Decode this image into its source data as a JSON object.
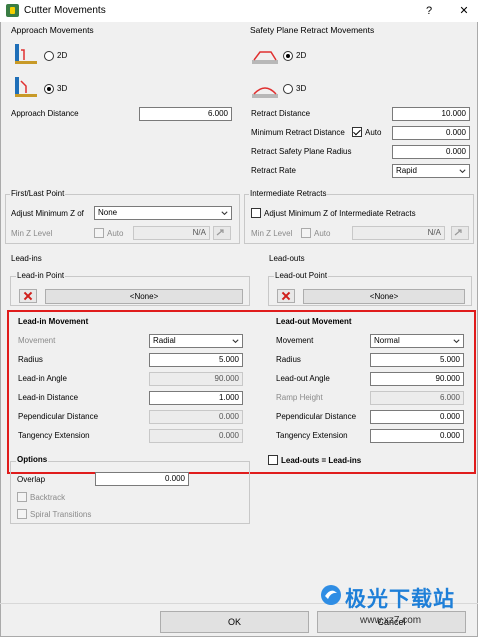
{
  "window": {
    "title": "Cutter Movements",
    "help": "?",
    "close": "✕"
  },
  "approach": {
    "title": "Approach Movements",
    "opt_2d": "2D",
    "opt_3d": "3D",
    "selected": "3D",
    "distance_label": "Approach Distance",
    "distance_value": "6.000"
  },
  "safety": {
    "title": "Safety Plane Retract Movements",
    "opt_2d": "2D",
    "opt_3d": "3D",
    "selected": "2D",
    "retract_distance_label": "Retract Distance",
    "retract_distance_value": "10.000",
    "min_retract_label": "Minimum Retract Distance",
    "auto_label": "Auto",
    "auto_checked": true,
    "min_retract_value": "0.000",
    "retract_radius_label": "Retract Safety Plane Radius",
    "retract_radius_value": "0.000",
    "retract_rate_label": "Retract Rate",
    "retract_rate_value": "Rapid"
  },
  "first_last": {
    "title": "First/Last Point",
    "adjust_label": "Adjust Minimum Z of",
    "adjust_value": "None",
    "min_z_label": "Min Z Level",
    "auto_label": "Auto",
    "min_z_value": "N/A"
  },
  "intermediate": {
    "title": "Intermediate Retracts",
    "adjust_label": "Adjust Minimum Z of Intermediate Retracts",
    "min_z_label": "Min Z Level",
    "auto_label": "Auto",
    "min_z_value": "N/A"
  },
  "leadins": {
    "title": "Lead-ins",
    "point_title": "Lead-in Point",
    "point_value": "<None>",
    "movement_title": "Lead-in Movement",
    "rows": [
      {
        "label": "Movement",
        "value": "Radial"
      },
      {
        "label": "Radius",
        "value": "5.000"
      },
      {
        "label": "Lead-in Angle",
        "value": "90.000"
      },
      {
        "label": "Lead-in Distance",
        "value": "1.000"
      },
      {
        "label": "Pependicular Distance",
        "value": "0.000"
      },
      {
        "label": "Tangency Extension",
        "value": "0.000"
      }
    ]
  },
  "leadouts": {
    "title": "Lead-outs",
    "point_title": "Lead-out Point",
    "point_value": "<None>",
    "movement_title": "Lead-out Movement",
    "rows": [
      {
        "label": "Movement",
        "value": "Normal"
      },
      {
        "label": "Radius",
        "value": "5.000"
      },
      {
        "label": "Lead-out Angle",
        "value": "90.000"
      },
      {
        "label": "Ramp Height",
        "value": "6.000"
      },
      {
        "label": "Pependicular Distance",
        "value": "0.000"
      },
      {
        "label": "Tangency Extension",
        "value": "0.000"
      }
    ],
    "equal_label": "Lead-outs = Lead-ins"
  },
  "options": {
    "title": "Options",
    "overlap_label": "Overlap",
    "overlap_value": "0.000",
    "backtrack_label": "Backtrack",
    "spiral_label": "Spiral Transitions"
  },
  "buttons": {
    "ok": "OK",
    "cancel": "Cancel"
  },
  "watermark": {
    "text": "极光下载站",
    "url": "www.xz7.com"
  },
  "colors": {
    "highlight": "#e01c1c",
    "delete_icon": "#d0201c"
  }
}
